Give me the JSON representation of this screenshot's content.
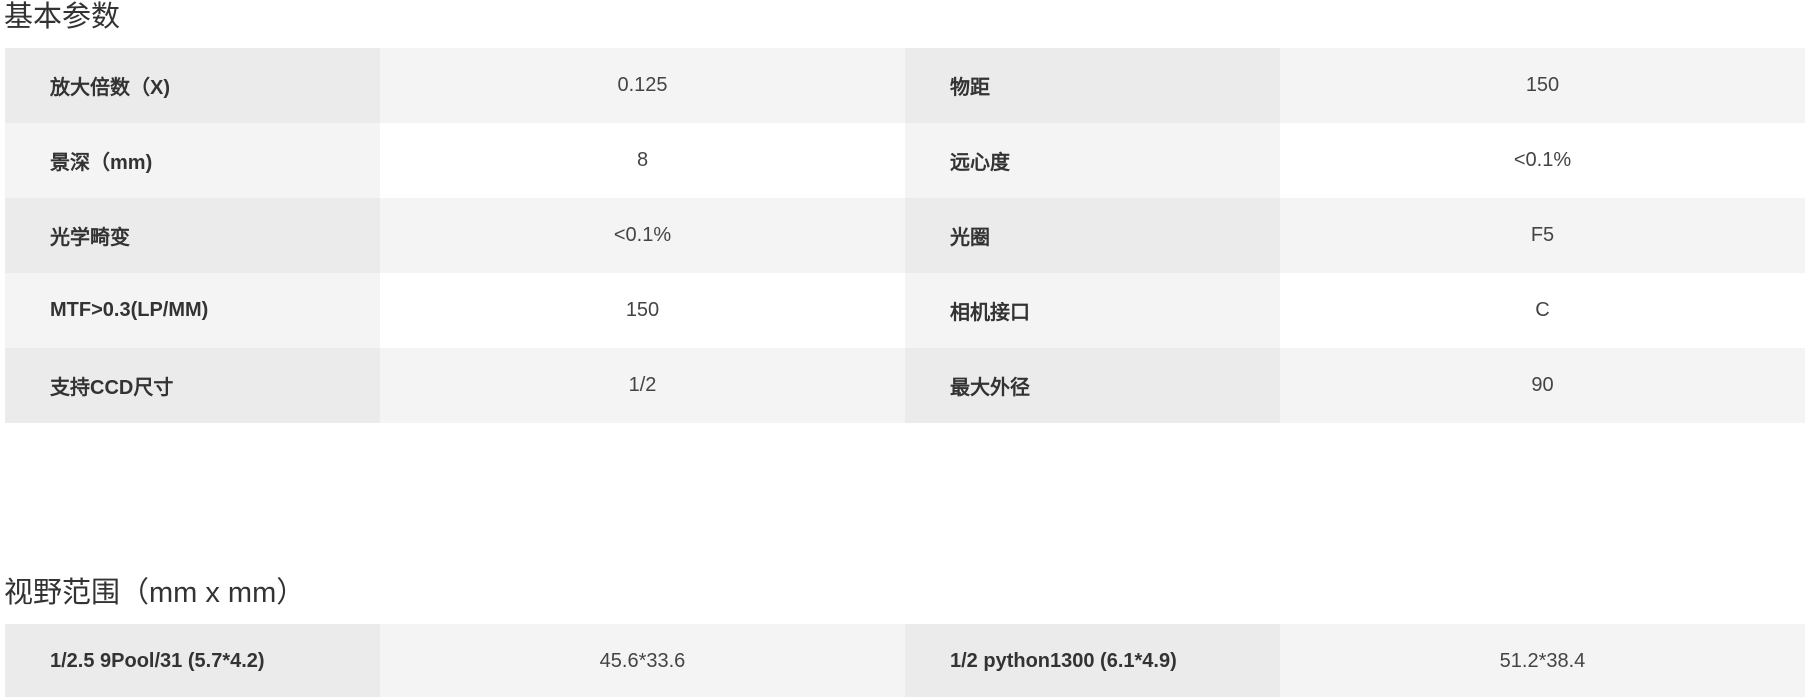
{
  "basic": {
    "title": "基本参数",
    "rows": [
      {
        "label1": "放大倍数（X)",
        "value1": "0.125",
        "label2": "物距",
        "value2": "150"
      },
      {
        "label1": "景深（mm)",
        "value1": "8",
        "label2": "远心度",
        "value2": "<0.1%"
      },
      {
        "label1": "光学畸变",
        "value1": "<0.1%",
        "label2": "光圈",
        "value2": "F5"
      },
      {
        "label1": "MTF>0.3(LP/MM)",
        "value1": "150",
        "label2": "相机接口",
        "value2": "C"
      },
      {
        "label1": "支持CCD尺寸",
        "value1": "1/2",
        "label2": "最大外径",
        "value2": "90"
      }
    ]
  },
  "fov": {
    "title": "视野范围（mm x mm）",
    "rows": [
      {
        "label1": "1/2.5 9Pool/31 (5.7*4.2)",
        "value1": "45.6*33.6",
        "label2": "1/2 python1300 (6.1*4.9)",
        "value2": "51.2*38.4"
      }
    ]
  }
}
